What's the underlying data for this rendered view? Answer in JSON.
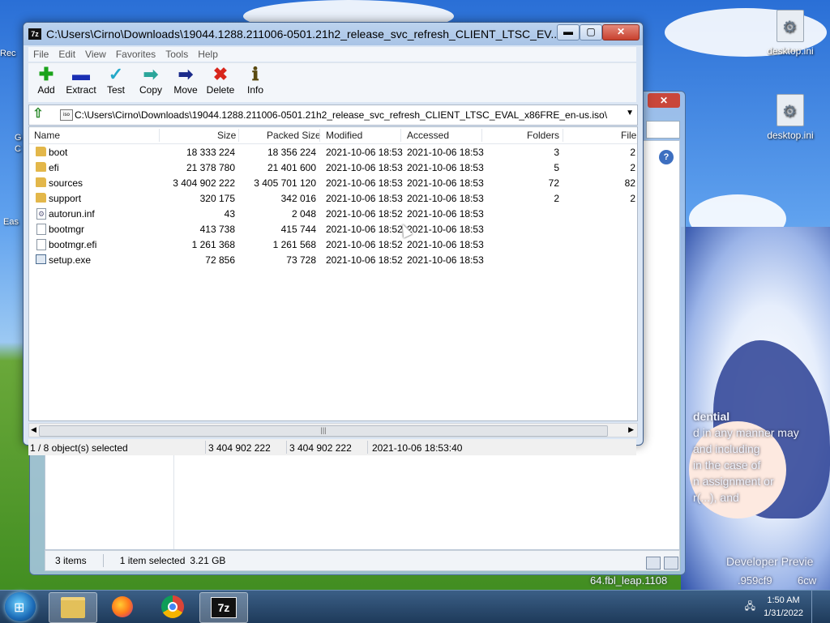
{
  "desktop": {
    "icons": [
      {
        "label": "desktop.ini"
      },
      {
        "label": "desktop.ini"
      }
    ],
    "left_stubs": [
      "Rec",
      "G",
      "C",
      "Eas"
    ],
    "watermark_lines": [
      "dential",
      "d in any manner may",
      "and including",
      "in the case of",
      "n assignment or",
      "r(...), and"
    ],
    "build_text": [
      "Developer Previe",
      "64.fbl_leap.1108",
      ".959cf9",
      "6cw"
    ]
  },
  "bg_window": {
    "status": {
      "items": "3 items",
      "selected": "1 item selected",
      "size": "3.21 GB"
    }
  },
  "window": {
    "app_icon": "7z",
    "title": "C:\\Users\\Cirno\\Downloads\\19044.1288.211006-0501.21h2_release_svc_refresh_CLIENT_LTSC_EV...",
    "controls": {
      "minimize": "▬",
      "maximize": "▢",
      "close": "✕"
    },
    "menu": [
      "File",
      "Edit",
      "View",
      "Favorites",
      "Tools",
      "Help"
    ],
    "toolbar": [
      {
        "label": "Add",
        "icon": "plus-icon",
        "glyph": "✚",
        "color": "#1aa31a"
      },
      {
        "label": "Extract",
        "icon": "minus-icon",
        "glyph": "▬",
        "color": "#1a2fb3"
      },
      {
        "label": "Test",
        "icon": "check-icon",
        "glyph": "✓",
        "color": "#24a9c9"
      },
      {
        "label": "Copy",
        "icon": "copy-arrow-icon",
        "glyph": "➡",
        "color": "#2aa59a"
      },
      {
        "label": "Move",
        "icon": "move-arrow-icon",
        "glyph": "➡",
        "color": "#1a2a8a"
      },
      {
        "label": "Delete",
        "icon": "delete-x-icon",
        "glyph": "✖",
        "color": "#d8261c"
      },
      {
        "label": "Info",
        "icon": "info-icon",
        "glyph": "ℹ",
        "color": "#5a4a10"
      }
    ],
    "address": {
      "iso_label": "iso",
      "path": "C:\\Users\\Cirno\\Downloads\\19044.1288.211006-0501.21h2_release_svc_refresh_CLIENT_LTSC_EVAL_x86FRE_en-us.iso\\"
    },
    "columns": [
      "Name",
      "Size",
      "Packed Size",
      "Modified",
      "Accessed",
      "Folders",
      "File"
    ],
    "rows": [
      {
        "name": "boot",
        "type": "folder",
        "size": "18 333 224",
        "packed": "18 356 224",
        "modified": "2021-10-06 18:53",
        "accessed": "2021-10-06 18:53",
        "folders": "3",
        "files": "2"
      },
      {
        "name": "efi",
        "type": "folder",
        "size": "21 378 780",
        "packed": "21 401 600",
        "modified": "2021-10-06 18:53",
        "accessed": "2021-10-06 18:53",
        "folders": "5",
        "files": "2"
      },
      {
        "name": "sources",
        "type": "folder",
        "size": "3 404 902 222",
        "packed": "3 405 701 120",
        "modified": "2021-10-06 18:53",
        "accessed": "2021-10-06 18:53",
        "folders": "72",
        "files": "82"
      },
      {
        "name": "support",
        "type": "folder",
        "size": "320 175",
        "packed": "342 016",
        "modified": "2021-10-06 18:53",
        "accessed": "2021-10-06 18:53",
        "folders": "2",
        "files": "2"
      },
      {
        "name": "autorun.inf",
        "type": "inf",
        "size": "43",
        "packed": "2 048",
        "modified": "2021-10-06 18:52",
        "accessed": "2021-10-06 18:53",
        "folders": "",
        "files": ""
      },
      {
        "name": "bootmgr",
        "type": "file",
        "size": "413 738",
        "packed": "415 744",
        "modified": "2021-10-06 18:52",
        "accessed": "2021-10-06 18:53",
        "folders": "",
        "files": ""
      },
      {
        "name": "bootmgr.efi",
        "type": "file",
        "size": "1 261 368",
        "packed": "1 261 568",
        "modified": "2021-10-06 18:52",
        "accessed": "2021-10-06 18:53",
        "folders": "",
        "files": ""
      },
      {
        "name": "setup.exe",
        "type": "exe",
        "size": "72 856",
        "packed": "73 728",
        "modified": "2021-10-06 18:52",
        "accessed": "2021-10-06 18:53",
        "folders": "",
        "files": ""
      }
    ],
    "status": {
      "selection": "1 / 8 object(s) selected",
      "size": "3 404 902 222",
      "packed": "3 404 902 222",
      "modified": "2021-10-06 18:53:40"
    }
  },
  "taskbar": {
    "apps": [
      "File Explorer",
      "Firefox",
      "Chrome",
      "7-Zip"
    ],
    "app_7z_label": "7z",
    "clock": {
      "time": "1:50 AM",
      "date": "1/31/2022"
    }
  }
}
